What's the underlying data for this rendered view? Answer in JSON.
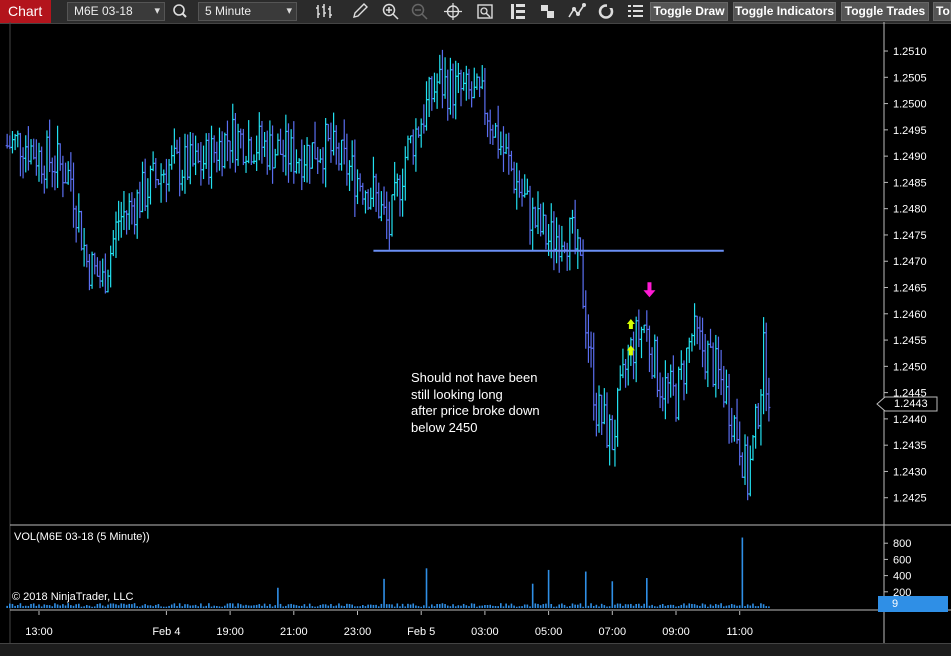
{
  "toolbar": {
    "tab_label": "Chart",
    "instrument": "M6E 03-18",
    "interval": "5 Minute",
    "toggle_draw": "Toggle Draw",
    "toggle_indicators": "Toggle Indicators",
    "toggle_trades": "Toggle Trades",
    "overflow_label": "To",
    "icons": [
      "search-icon",
      "bar-style-icon",
      "pencil-icon",
      "zoom-in-icon",
      "zoom-out-icon",
      "crosshair-icon",
      "properties-icon",
      "data-box-icon",
      "stack-icon",
      "strategy-icon",
      "refresh-icon",
      "list-icon"
    ]
  },
  "annotation": {
    "lines": [
      "Should not have been",
      "still looking long",
      "after price broke down",
      "below 2450"
    ]
  },
  "price_tag": "1.2443",
  "volume_panel": {
    "title": "VOL(M6E 03-18 (5 Minute))",
    "last_value": "9"
  },
  "copyright": "© 2018 NinjaTrader, LLC",
  "colors": {
    "up": "#22e0f0",
    "down": "#5a6ef0",
    "support_line": "#6a8ff5",
    "volume": "#2f8fe6",
    "marker_down": "#ff1ad4",
    "marker_up": "#d6ff00",
    "tab_red": "#b3141c"
  },
  "chart_data": [
    {
      "type": "candlestick",
      "title": "",
      "x_tick_labels": [
        "13:00",
        "Feb 4",
        "19:00",
        "21:00",
        "23:00",
        "Feb 5",
        "03:00",
        "05:00",
        "07:00",
        "09:00",
        "11:00"
      ],
      "y_tick_labels": [
        "1.2510",
        "1.2505",
        "1.2500",
        "1.2495",
        "1.2490",
        "1.2485",
        "1.2480",
        "1.2475",
        "1.2470",
        "1.2465",
        "1.2460",
        "1.2455",
        "1.2450",
        "1.2445",
        "1.2440",
        "1.2435",
        "1.2430",
        "1.2425"
      ],
      "ylim": [
        1.242,
        1.2514
      ],
      "last_price": 1.2443,
      "support_line": {
        "price": 1.2472,
        "from": "23:30",
        "to": "10:30"
      },
      "price_path": [
        {
          "t": "12:00",
          "p": 1.2492
        },
        {
          "t": "12:30",
          "p": 1.2493
        },
        {
          "t": "13:00",
          "p": 1.249
        },
        {
          "t": "13:30",
          "p": 1.2489
        },
        {
          "t": "14:00",
          "p": 1.2486
        },
        {
          "t": "14:30",
          "p": 1.247
        },
        {
          "t": "15:00",
          "p": 1.2466
        },
        {
          "t": "15:30",
          "p": 1.2478
        },
        {
          "t": "16:00",
          "p": 1.2481
        },
        {
          "t": "17:00",
          "p": 1.2488
        },
        {
          "t": "18:00",
          "p": 1.2488
        },
        {
          "t": "19:00",
          "p": 1.2494
        },
        {
          "t": "20:00",
          "p": 1.2492
        },
        {
          "t": "21:00",
          "p": 1.249
        },
        {
          "t": "22:00",
          "p": 1.2492
        },
        {
          "t": "23:00",
          "p": 1.2486
        },
        {
          "t": "23:30",
          "p": 1.2483
        },
        {
          "t": "00:00",
          "p": 1.2476
        },
        {
          "t": "00:30",
          "p": 1.249
        },
        {
          "t": "01:00",
          "p": 1.2497
        },
        {
          "t": "01:30",
          "p": 1.2504
        },
        {
          "t": "02:00",
          "p": 1.2503
        },
        {
          "t": "03:00",
          "p": 1.25
        },
        {
          "t": "03:30",
          "p": 1.2492
        },
        {
          "t": "04:00",
          "p": 1.2485
        },
        {
          "t": "04:30",
          "p": 1.2478
        },
        {
          "t": "05:00",
          "p": 1.2474
        },
        {
          "t": "05:30",
          "p": 1.2476
        },
        {
          "t": "05:45",
          "p": 1.2474
        },
        {
          "t": "06:00",
          "p": 1.2468
        },
        {
          "t": "06:15",
          "p": 1.2455
        },
        {
          "t": "06:30",
          "p": 1.2442
        },
        {
          "t": "07:00",
          "p": 1.2436
        },
        {
          "t": "07:30",
          "p": 1.2452
        },
        {
          "t": "08:00",
          "p": 1.2458
        },
        {
          "t": "08:30",
          "p": 1.2447
        },
        {
          "t": "09:00",
          "p": 1.2444
        },
        {
          "t": "09:30",
          "p": 1.2456
        },
        {
          "t": "10:00",
          "p": 1.2452
        },
        {
          "t": "10:30",
          "p": 1.2446
        },
        {
          "t": "11:00",
          "p": 1.2436
        },
        {
          "t": "11:15",
          "p": 1.2428
        },
        {
          "t": "11:30",
          "p": 1.2438
        },
        {
          "t": "11:45",
          "p": 1.2452
        },
        {
          "t": "12:00",
          "p": 1.2443
        }
      ]
    },
    {
      "type": "bar",
      "title": "VOL(M6E 03-18 (5 Minute))",
      "y_tick_labels": [
        "800",
        "600",
        "400",
        "200"
      ],
      "ylim": [
        0,
        1000
      ],
      "last_value": 9,
      "notable_spikes": [
        {
          "t": "20:30",
          "v": 250
        },
        {
          "t": "23:50",
          "v": 360
        },
        {
          "t": "01:10",
          "v": 490
        },
        {
          "t": "04:30",
          "v": 300
        },
        {
          "t": "05:00",
          "v": 470
        },
        {
          "t": "06:10",
          "v": 450
        },
        {
          "t": "07:00",
          "v": 330
        },
        {
          "t": "08:05",
          "v": 370
        },
        {
          "t": "11:05",
          "v": 870
        }
      ]
    }
  ]
}
